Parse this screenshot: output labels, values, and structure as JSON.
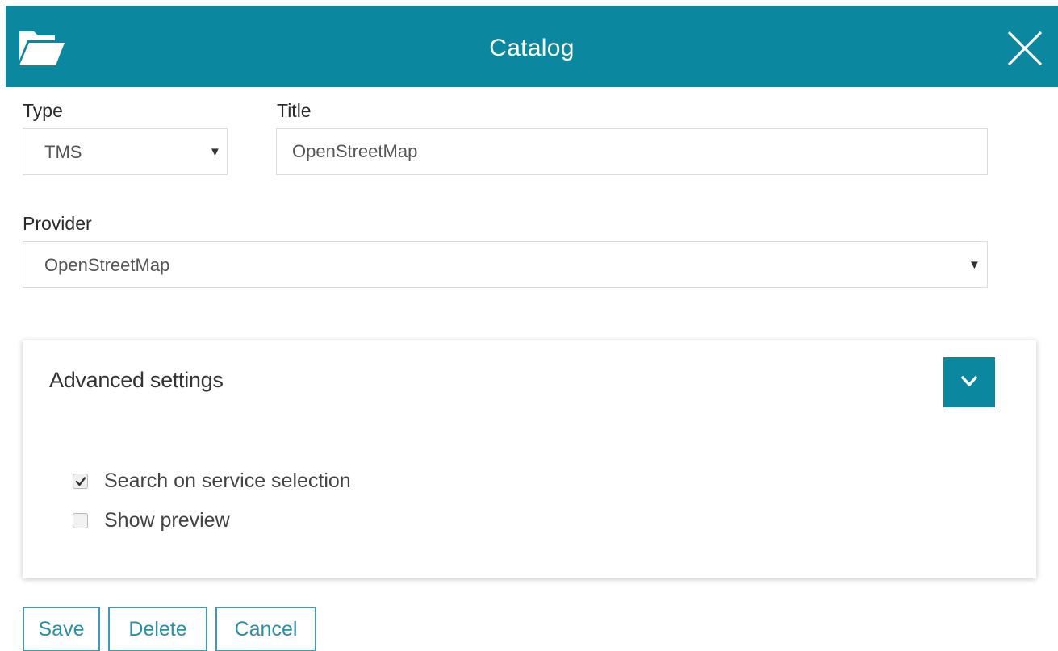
{
  "header": {
    "title": "Catalog",
    "background_color": "#0c87a0",
    "left_icon": "folder-open-icon",
    "right_icon": "close-icon"
  },
  "form": {
    "type": {
      "label": "Type",
      "value": "TMS"
    },
    "title": {
      "label": "Title",
      "value": "OpenStreetMap"
    },
    "provider": {
      "label": "Provider",
      "value": "OpenStreetMap"
    }
  },
  "advanced": {
    "title": "Advanced settings",
    "toggle_icon": "chevron-down-icon",
    "options": [
      {
        "label": "Search on service selection",
        "checked": true
      },
      {
        "label": "Show preview",
        "checked": false
      }
    ]
  },
  "buttons": {
    "save": "Save",
    "delete": "Delete",
    "cancel": "Cancel"
  }
}
